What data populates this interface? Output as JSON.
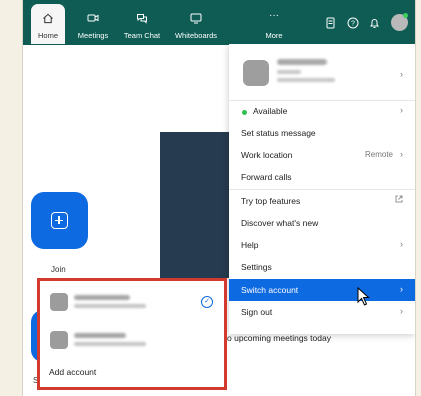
{
  "topbar": {
    "tabs": [
      {
        "label": "Home",
        "icon": "home-icon"
      },
      {
        "label": "Meetings",
        "icon": "video-camera-icon"
      },
      {
        "label": "Team Chat",
        "icon": "chat-bubbles-icon"
      },
      {
        "label": "Whiteboards",
        "icon": "whiteboard-icon"
      },
      {
        "label": "More",
        "icon": "more-dots-icon"
      }
    ],
    "right_icons": [
      "contacts-icon",
      "help-icon",
      "bell-icon",
      "avatar"
    ],
    "color": "#0e5c54"
  },
  "main": {
    "join_label": "Join",
    "schedule_peek": "S",
    "upcoming_text": "o upcoming meetings today"
  },
  "profile_menu": {
    "items": [
      {
        "label": "Available",
        "status_color": "#2fbf4f"
      },
      {
        "label": "Set status message"
      },
      {
        "label": "Work location",
        "value": "Remote"
      },
      {
        "label": "Forward calls"
      },
      {
        "label": "Try top features"
      },
      {
        "label": "Discover what's new"
      },
      {
        "label": "Help"
      },
      {
        "label": "Settings"
      },
      {
        "label": "Switch account"
      },
      {
        "label": "Sign out"
      }
    ],
    "active_color": "#0e6ae0"
  },
  "switch_account_popup": {
    "add_account_label": "Add account",
    "highlight_color": "#d33a2f"
  }
}
